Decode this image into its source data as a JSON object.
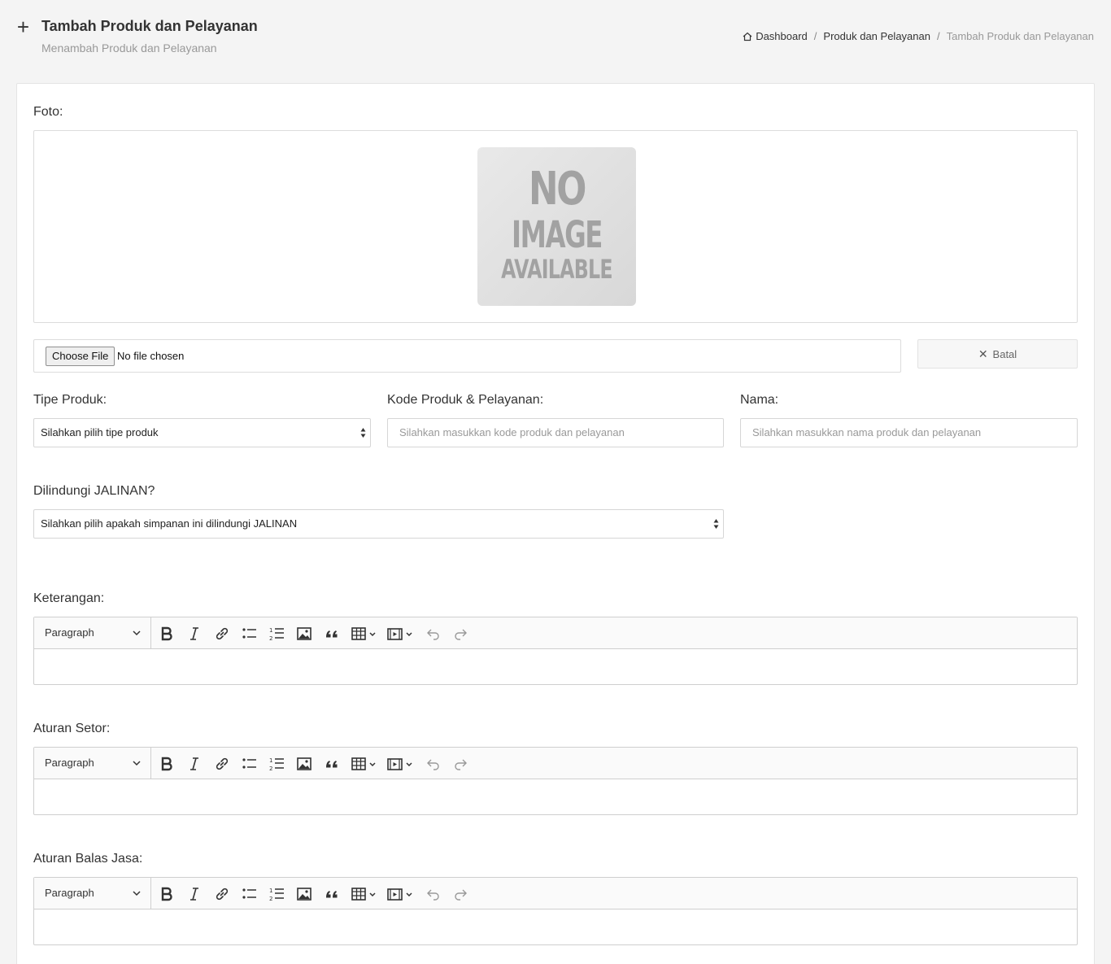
{
  "header": {
    "title": "Tambah Produk dan Pelayanan",
    "subtitle": "Menambah Produk dan Pelayanan",
    "breadcrumb": [
      "Dashboard",
      "Produk dan Pelayanan",
      "Tambah Produk dan Pelayanan"
    ]
  },
  "form": {
    "foto_label": "Foto:",
    "no_image": [
      "NO",
      "IMAGE",
      "AVAILABLE"
    ],
    "choose_file_label": "Choose File",
    "file_status": "No file chosen",
    "batal_label": "Batal",
    "tipe_label": "Tipe Produk:",
    "tipe_value": "Silahkan pilih tipe produk",
    "kode_label": "Kode Produk & Pelayanan:",
    "kode_placeholder": "Silahkan masukkan kode produk dan pelayanan",
    "nama_label": "Nama:",
    "nama_placeholder": "Silahkan masukkan nama produk dan pelayanan",
    "jalinan_label": "Dilindungi JALINAN?",
    "jalinan_value": "Silahkan pilih apakah simpanan ini dilindungi JALINAN"
  },
  "editors": [
    {
      "label": "Keterangan:",
      "paragraph": "Paragraph"
    },
    {
      "label": "Aturan Setor:",
      "paragraph": "Paragraph"
    },
    {
      "label": "Aturan Balas Jasa:",
      "paragraph": "Paragraph"
    }
  ],
  "toolbar_icons": [
    "bold-icon",
    "italic-icon",
    "link-icon",
    "bulleted-list-icon",
    "numbered-list-icon",
    "image-icon",
    "blockquote-icon",
    "table-icon",
    "media-icon",
    "undo-icon",
    "redo-icon"
  ]
}
